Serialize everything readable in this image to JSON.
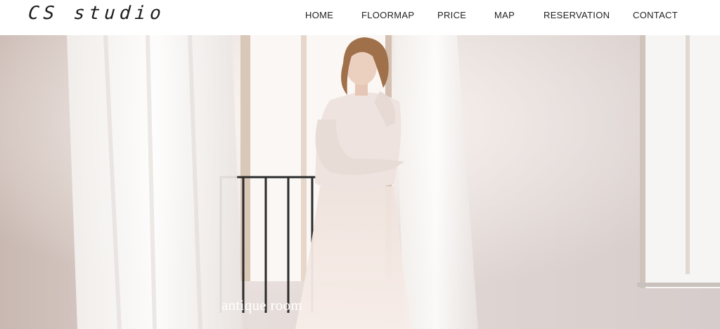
{
  "header": {
    "logo_text": "CS studio",
    "nav": [
      {
        "label": "HOME"
      },
      {
        "label": "FLOORMAP"
      },
      {
        "label": "PRICE"
      },
      {
        "label": "MAP"
      },
      {
        "label": "RESERVATION"
      },
      {
        "label": "CONTACT"
      }
    ]
  },
  "hero": {
    "caption": "antique room",
    "image_description_icon": "woman-in-white-dress-photo"
  },
  "colors": {
    "header_bg": "#ffffff",
    "text": "#222222",
    "caption": "#ffffff"
  }
}
